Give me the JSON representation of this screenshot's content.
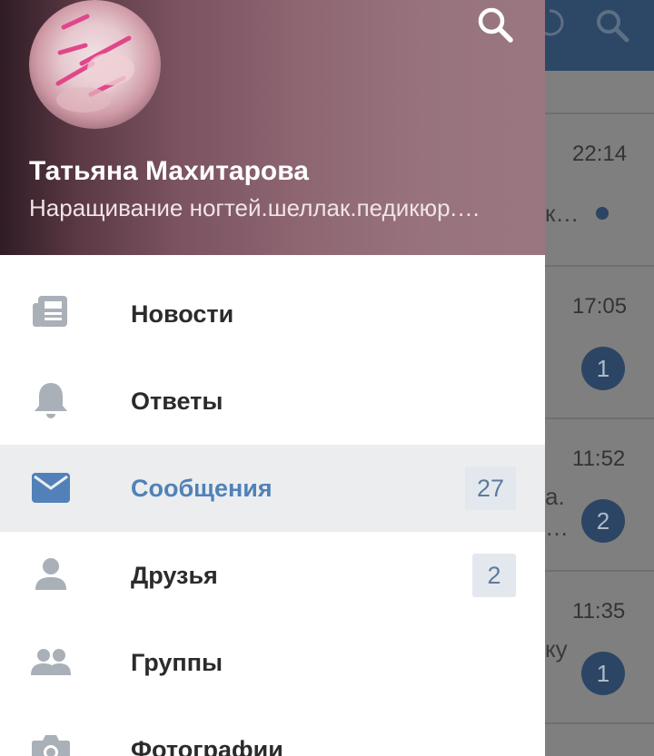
{
  "drawer": {
    "user": {
      "name": "Татьяна Махитарова",
      "status": "Наращивание ногтей.шеллак.педикюр.…"
    },
    "header_icon": "search-icon",
    "menu": [
      {
        "label": "Новости",
        "icon": "newspaper-icon",
        "count": null,
        "active": false
      },
      {
        "label": "Ответы",
        "icon": "bell-icon",
        "count": null,
        "active": false
      },
      {
        "label": "Сообщения",
        "icon": "envelope-icon",
        "count": "27",
        "active": true
      },
      {
        "label": "Друзья",
        "icon": "person-icon",
        "count": "2",
        "active": false
      },
      {
        "label": "Группы",
        "icon": "group-icon",
        "count": null,
        "active": false
      },
      {
        "label": "Фотографии",
        "icon": "camera-icon",
        "count": null,
        "active": false
      }
    ]
  },
  "background": {
    "conversations": [
      {
        "time": "22:14",
        "snippet": "к…",
        "badge": null,
        "unread_dot": true
      },
      {
        "time": "17:05",
        "snippet": "",
        "badge": "1",
        "unread_dot": false
      },
      {
        "time": "11:52",
        "snippet": "а.",
        "snippet2": "…",
        "badge": "2",
        "unread_dot": false
      },
      {
        "time": "11:35",
        "snippet": "ку",
        "badge": "1",
        "unread_dot": false
      }
    ]
  },
  "colors": {
    "accent": "#5181b8",
    "active_row": "#ebedef",
    "counter_bg": "#e3e8ee",
    "topbar": "#2d4766"
  }
}
